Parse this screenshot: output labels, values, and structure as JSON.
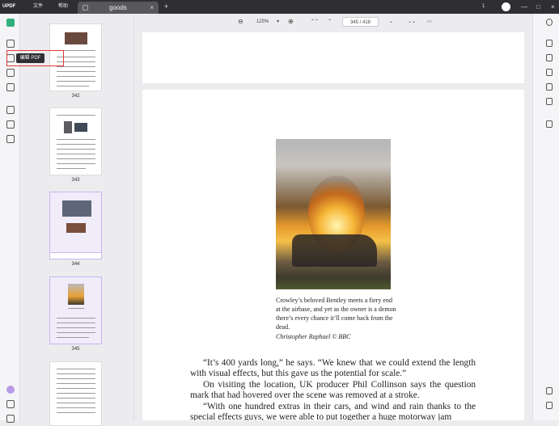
{
  "app": {
    "logo": "UPDF",
    "menus": [
      "文件",
      "帮助"
    ],
    "tab_title": "goods",
    "tab_close": "×",
    "tab_add": "+",
    "page_count": "1",
    "win_min": "—",
    "win_max": "□",
    "win_close": "×"
  },
  "tooltip": "编辑 PDF",
  "thumbnails": [
    {
      "num": "342"
    },
    {
      "num": "343"
    },
    {
      "num": "344"
    },
    {
      "num": "345"
    }
  ],
  "toolbar": {
    "zoom_out": "⊖",
    "zoom": "125%",
    "zoom_dropdown": "▾",
    "zoom_in": "⊕",
    "first_page": "⌃⌃",
    "prev_page": "⌃",
    "current_page": "345",
    "total_pages": "418",
    "next_page": "⌄",
    "last_page": "⌄⌄",
    "comment": "▭"
  },
  "document": {
    "caption": "Crowley’s beloved Bentley meets a fiery end at the airbase, and yet as the owner is a demon there’s every chance it’ll come back from the dead.",
    "credit": "Christopher Raphael © BBC",
    "paragraphs": [
      "“It’s 400 yards long,” he says. “We knew that we could extend the length with visual effects, but this gave us the potential for scale.”",
      "On visiting the location, UK producer Phil Collinson says the question mark that had hovered over the scene was removed at a stroke.",
      "“With one hundred extras in their cars, and wind and rain thanks to the special effects guys, we were able to put together a huge motorway jam"
    ]
  },
  "colors": {
    "accent": "#2fb07a",
    "selection": "#c8b6ee",
    "highlight_box": "#e53935"
  }
}
